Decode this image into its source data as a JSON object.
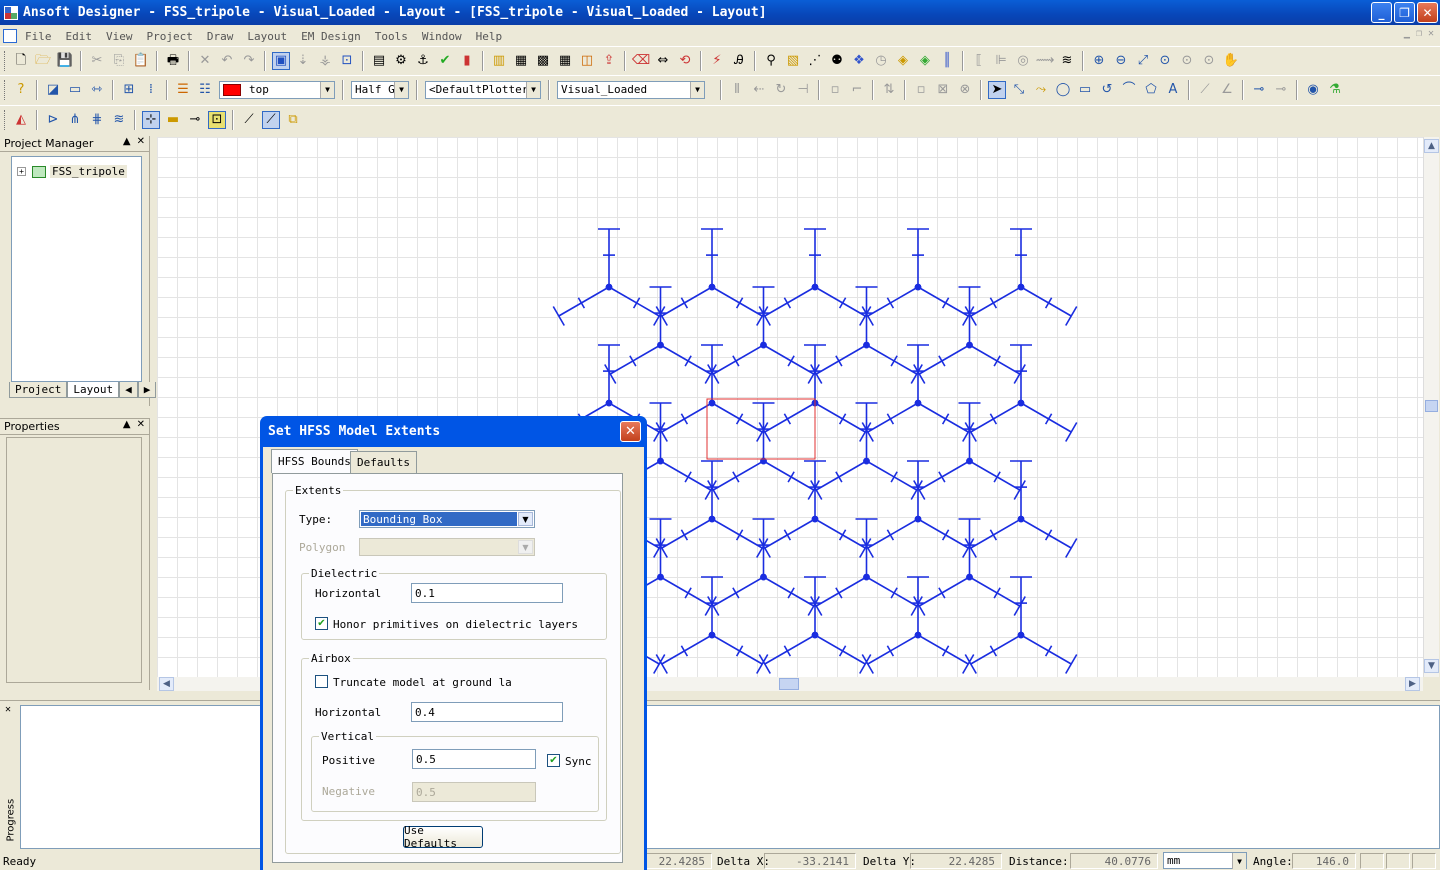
{
  "window": {
    "title": "Ansoft Designer - FSS_tripole - Visual_Loaded - Layout - [FSS_tripole - Visual_Loaded - Layout]"
  },
  "menu": [
    "File",
    "Edit",
    "View",
    "Project",
    "Draw",
    "Layout",
    "EM Design",
    "Tools",
    "Window",
    "Help"
  ],
  "toolbar": {
    "layer_color": "#ff0000",
    "layer_value": "top",
    "half_value": "Half G",
    "plotter_value": "<DefaultPlotter>",
    "design_value": "Visual_Loaded"
  },
  "project_manager": {
    "title": "Project Manager",
    "root_item": "FSS_tripole",
    "tab_project": "Project",
    "tab_layout": "Layout"
  },
  "properties": {
    "title": "Properties"
  },
  "progress_label": "Progress",
  "status": {
    "ready": "Ready",
    "first_value": "22.4285",
    "delta_x_label": "Delta X:",
    "delta_x_value": "-33.2141",
    "delta_y_label": "Delta Y:",
    "delta_y_value": "22.4285",
    "distance_label": "Distance:",
    "distance_value": "40.0776",
    "units_value": "mm",
    "angle_label": "Angle:",
    "angle_value": "146.0"
  },
  "dialog": {
    "title": "Set HFSS Model Extents",
    "tab_bounds": "HFSS Bounds",
    "tab_defaults": "Defaults",
    "extents_label": "Extents",
    "type_label": "Type:",
    "type_value": "Bounding Box",
    "polygon_label": "Polygon",
    "dielectric_label": "Dielectric",
    "diel_horizontal_label": "Horizontal",
    "diel_horizontal_value": "0.1",
    "honor_label": "Honor primitives on dielectric layers",
    "honor_checked": true,
    "airbox_label": "Airbox",
    "truncate_label": "Truncate model at ground la",
    "truncate_checked": false,
    "air_horizontal_label": "Horizontal",
    "air_horizontal_value": "0.4",
    "vertical_label": "Vertical",
    "positive_label": "Positive",
    "positive_value": "0.5",
    "sync_label": "Sync",
    "sync_checked": true,
    "negative_label": "Negative",
    "negative_value": "0.5",
    "use_defaults_label": "Use Defaults"
  },
  "colors": {
    "pattern": "#1a2de0",
    "selection": "#e03030",
    "title_blue": "#0a5ed6"
  }
}
